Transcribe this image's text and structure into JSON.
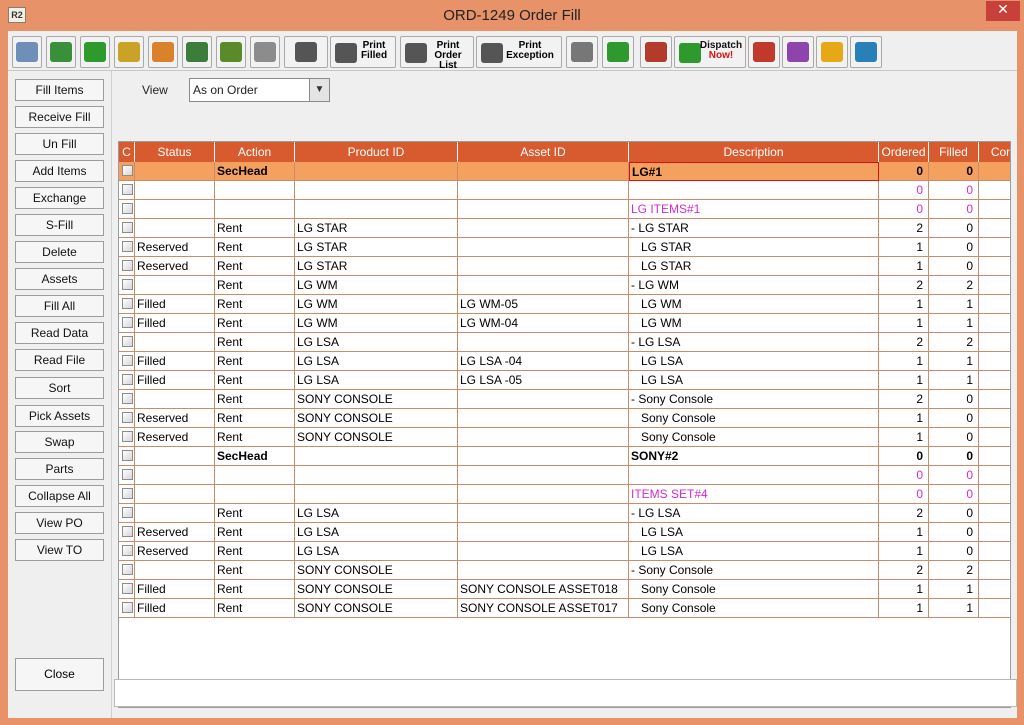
{
  "window": {
    "title": "ORD-1249 Order Fill",
    "app_icon_text": "R2",
    "close_glyph": "✕"
  },
  "toolbar": {
    "buttons": [
      {
        "icon": "binoculars-icon",
        "color": "#6d8fb8"
      },
      {
        "icon": "pick-list-icon",
        "color": "#3a8f3a"
      },
      {
        "icon": "refresh-icon",
        "color": "#2e9a2e"
      },
      {
        "icon": "edit-note-icon",
        "color": "#c9a227"
      },
      {
        "icon": "filter-funnel-icon",
        "color": "#d9822b"
      },
      {
        "icon": "zoom-icon",
        "color": "#3c7d3c"
      },
      {
        "icon": "filter-check-icon",
        "color": "#5a8a2a"
      },
      {
        "icon": "stack-icon",
        "color": "#8c8c8c"
      },
      {
        "icon": "printer-menu-icon",
        "color": "#555555"
      }
    ],
    "print_filled": [
      "Print",
      "Filled"
    ],
    "print_order_list": [
      "Print",
      "Order List"
    ],
    "print_exception": [
      "Print",
      "Exception"
    ],
    "extra_buttons": [
      {
        "icon": "scanner-icon",
        "color": "#777777"
      },
      {
        "icon": "add-remove-icon",
        "color": "#2e9a2e"
      },
      {
        "icon": "barcode-alert-icon",
        "color": "#b33b2b"
      }
    ],
    "dispatch": [
      "Dispatch",
      "Now!"
    ],
    "right_buttons": [
      {
        "icon": "truck-icon",
        "color": "#c0392b"
      },
      {
        "icon": "schedule-clock-icon",
        "color": "#8e44ad"
      },
      {
        "icon": "warning-document-icon",
        "color": "#e6a817"
      },
      {
        "icon": "grid-settings-icon",
        "color": "#2980b9"
      }
    ]
  },
  "side_buttons": [
    "Fill Items",
    "Receive Fill",
    "Un Fill",
    "Add Items",
    "Exchange",
    "S-Fill",
    "Delete",
    "Assets",
    "Fill  All",
    "Read Data",
    "Read File",
    "Sort",
    "Pick Assets",
    "Swap",
    "Parts",
    "Collapse All",
    "View PO",
    "View TO"
  ],
  "close_label": "Close",
  "view": {
    "label": "View",
    "value": "As on Order"
  },
  "grid": {
    "columns": [
      "C",
      "Status",
      "Action",
      "Product ID",
      "Asset ID",
      "Description",
      "Ordered",
      "Filled",
      "Cont"
    ],
    "rows": [
      {
        "status": "",
        "action": "SecHead",
        "product": "",
        "asset": "",
        "desc": "LG#1",
        "ordered": "0",
        "filled": "0",
        "style": "section"
      },
      {
        "status": "",
        "action": "",
        "product": "",
        "asset": "",
        "desc": "",
        "ordered": "0",
        "filled": "0",
        "style": "magenta"
      },
      {
        "status": "",
        "action": "",
        "product": "",
        "asset": "",
        "desc": "LG ITEMS#1",
        "ordered": "0",
        "filled": "0",
        "style": "magenta"
      },
      {
        "status": "",
        "action": "Rent",
        "product": "LG STAR",
        "asset": "",
        "desc": "- LG STAR",
        "ordered": "2",
        "filled": "0",
        "style": ""
      },
      {
        "status": "Reserved",
        "action": "Rent",
        "product": "LG STAR",
        "asset": "",
        "desc": "   LG STAR",
        "ordered": "1",
        "filled": "0",
        "style": ""
      },
      {
        "status": "Reserved",
        "action": "Rent",
        "product": "LG STAR",
        "asset": "",
        "desc": "   LG STAR",
        "ordered": "1",
        "filled": "0",
        "style": ""
      },
      {
        "status": "",
        "action": "Rent",
        "product": "LG WM",
        "asset": "",
        "desc": "- LG WM",
        "ordered": "2",
        "filled": "2",
        "style": ""
      },
      {
        "status": "Filled",
        "action": "Rent",
        "product": "LG WM",
        "asset": "LG WM-05",
        "desc": "   LG WM",
        "ordered": "1",
        "filled": "1",
        "style": ""
      },
      {
        "status": "Filled",
        "action": "Rent",
        "product": "LG WM",
        "asset": "LG WM-04",
        "desc": "   LG WM",
        "ordered": "1",
        "filled": "1",
        "style": ""
      },
      {
        "status": "",
        "action": "Rent",
        "product": "LG LSA",
        "asset": "",
        "desc": "- LG LSA",
        "ordered": "2",
        "filled": "2",
        "style": ""
      },
      {
        "status": "Filled",
        "action": "Rent",
        "product": "LG LSA",
        "asset": "LG LSA -04",
        "desc": "   LG LSA",
        "ordered": "1",
        "filled": "1",
        "style": ""
      },
      {
        "status": "Filled",
        "action": "Rent",
        "product": "LG LSA",
        "asset": "LG LSA -05",
        "desc": "   LG LSA",
        "ordered": "1",
        "filled": "1",
        "style": ""
      },
      {
        "status": "",
        "action": "Rent",
        "product": "SONY CONSOLE",
        "asset": "",
        "desc": "- Sony Console",
        "ordered": "2",
        "filled": "0",
        "style": ""
      },
      {
        "status": "Reserved",
        "action": "Rent",
        "product": "SONY CONSOLE",
        "asset": "",
        "desc": "   Sony Console",
        "ordered": "1",
        "filled": "0",
        "style": ""
      },
      {
        "status": "Reserved",
        "action": "Rent",
        "product": "SONY CONSOLE",
        "asset": "",
        "desc": "   Sony Console",
        "ordered": "1",
        "filled": "0",
        "style": ""
      },
      {
        "status": "",
        "action": "SecHead",
        "product": "",
        "asset": "",
        "desc": "SONY#2",
        "ordered": "0",
        "filled": "0",
        "style": "section2"
      },
      {
        "status": "",
        "action": "",
        "product": "",
        "asset": "",
        "desc": "",
        "ordered": "0",
        "filled": "0",
        "style": "magenta"
      },
      {
        "status": "",
        "action": "",
        "product": "",
        "asset": "",
        "desc": "ITEMS SET#4",
        "ordered": "0",
        "filled": "0",
        "style": "magenta"
      },
      {
        "status": "",
        "action": "Rent",
        "product": "LG LSA",
        "asset": "",
        "desc": "- LG LSA",
        "ordered": "2",
        "filled": "0",
        "style": ""
      },
      {
        "status": "Reserved",
        "action": "Rent",
        "product": "LG LSA",
        "asset": "",
        "desc": "   LG LSA",
        "ordered": "1",
        "filled": "0",
        "style": ""
      },
      {
        "status": "Reserved",
        "action": "Rent",
        "product": "LG LSA",
        "asset": "",
        "desc": "   LG LSA",
        "ordered": "1",
        "filled": "0",
        "style": ""
      },
      {
        "status": "",
        "action": "Rent",
        "product": "SONY CONSOLE",
        "asset": "",
        "desc": "- Sony Console",
        "ordered": "2",
        "filled": "2",
        "style": ""
      },
      {
        "status": "Filled",
        "action": "Rent",
        "product": "SONY CONSOLE",
        "asset": "SONY CONSOLE ASSET018",
        "desc": "   Sony Console",
        "ordered": "1",
        "filled": "1",
        "style": ""
      },
      {
        "status": "Filled",
        "action": "Rent",
        "product": "SONY CONSOLE",
        "asset": "SONY CONSOLE ASSET017",
        "desc": "   Sony Console",
        "ordered": "1",
        "filled": "1",
        "style": ""
      }
    ]
  },
  "scrollbar": {
    "left_arrow": "◀",
    "right_arrow": "▶"
  },
  "colors": {
    "accent": "#d85b2f",
    "frame": "#e8926a",
    "highlight_row": "#f4a160",
    "magenta_text": "#d42bcf"
  }
}
